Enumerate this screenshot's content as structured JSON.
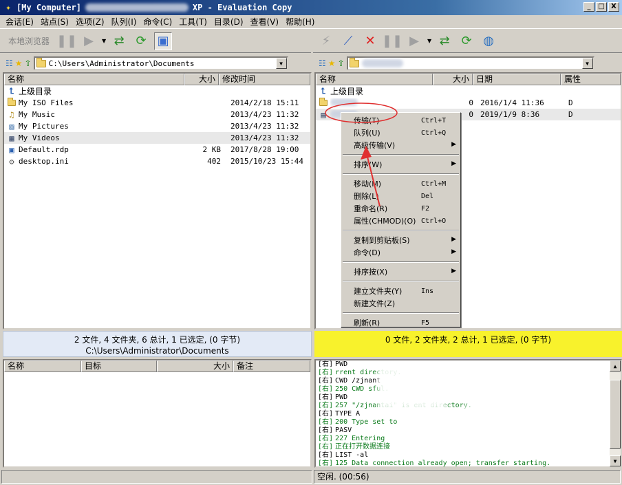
{
  "window": {
    "title_prefix": "[My Computer]",
    "title_suffix": "XP - Evaluation Copy",
    "controls": {
      "minimize": "_",
      "maximize": "□",
      "close": "X"
    }
  },
  "menu": [
    "会话(E)",
    "站点(S)",
    "选项(Z)",
    "队列(I)",
    "命令(C)",
    "工具(T)",
    "目录(D)",
    "查看(V)",
    "帮助(H)"
  ],
  "toolbar": {
    "local_browser": "本地浏览器"
  },
  "left": {
    "path": "C:\\Users\\Administrator\\Documents",
    "columns": {
      "name": "名称",
      "size": "大小",
      "modified": "修改时间"
    },
    "parent": "上级目录",
    "files": [
      {
        "name": "My ISO Files",
        "size": "",
        "date": "2014/2/18 15:11",
        "icon": "folder"
      },
      {
        "name": "My Music",
        "size": "",
        "date": "2013/4/23 11:32",
        "icon": "music-folder"
      },
      {
        "name": "My Pictures",
        "size": "",
        "date": "2013/4/23 11:32",
        "icon": "pictures-folder"
      },
      {
        "name": "My Videos",
        "size": "",
        "date": "2013/4/23 11:32",
        "icon": "videos-folder"
      },
      {
        "name": "Default.rdp",
        "size": "2 KB",
        "date": "2017/8/28 19:00",
        "icon": "rdp-file"
      },
      {
        "name": "desktop.ini",
        "size": "402",
        "date": "2015/10/23 15:44",
        "icon": "ini-file"
      }
    ],
    "status_line1": "2 文件, 4 文件夹, 6 总计, 1 已选定, (0 字节)",
    "status_line2": "C:\\Users\\Administrator\\Documents"
  },
  "right": {
    "columns": {
      "name": "名称",
      "size": "大小",
      "date": "日期",
      "attr": "属性"
    },
    "parent": "上级目录",
    "files": [
      {
        "size": "0",
        "date": "2016/1/4 11:36",
        "attr": "D"
      },
      {
        "size": "0",
        "date": "2019/1/9 8:36",
        "attr": "D"
      }
    ],
    "status": "0 文件, 2 文件夹, 2 总计, 1 已选定, (0 字节)"
  },
  "queue": {
    "columns": {
      "name": "名称",
      "target": "目标",
      "size": "大小",
      "note": "备注"
    }
  },
  "log": [
    {
      "tag": "[右]",
      "text": "PWD",
      "green": false
    },
    {
      "tag": "[右]",
      "text": "rrent directory.",
      "green": true
    },
    {
      "tag": "[右]",
      "text": "CWD /zjnant",
      "green": false
    },
    {
      "tag": "[右]",
      "text": "250 CWD            sful.",
      "green": true
    },
    {
      "tag": "[右]",
      "text": "PWD",
      "green": false
    },
    {
      "tag": "[右]",
      "text": "257 \"/zjnantai\" is    ent directory.",
      "green": true
    },
    {
      "tag": "[右]",
      "text": "TYPE A",
      "green": false
    },
    {
      "tag": "[右]",
      "text": "200 Type set to",
      "green": true
    },
    {
      "tag": "[右]",
      "text": "PASV",
      "green": false
    },
    {
      "tag": "[右]",
      "text": "227 Entering",
      "green": true
    },
    {
      "tag": "[右]",
      "text": "正在打开数据连接",
      "green": true
    },
    {
      "tag": "[右]",
      "text": "LIST -al",
      "green": false
    },
    {
      "tag": "[右]",
      "text": "125 Data connection already open; transfer starting.",
      "green": true
    }
  ],
  "bottom_status": {
    "right": "空闲. (00:56)"
  },
  "context_menu": [
    {
      "label": "传输(T)",
      "key": "Ctrl+T",
      "sub": false
    },
    {
      "label": "队列(U)",
      "key": "Ctrl+Q",
      "sub": false
    },
    {
      "label": "高级传输(V)",
      "key": "",
      "sub": true
    },
    {
      "sep": true
    },
    {
      "label": "排序(W)",
      "key": "",
      "sub": true
    },
    {
      "sep": true
    },
    {
      "label": "移动(M)",
      "key": "Ctrl+M",
      "sub": false
    },
    {
      "label": "删除(L)",
      "key": "Del",
      "sub": false
    },
    {
      "label": "重命名(R)",
      "key": "F2",
      "sub": false
    },
    {
      "label": "属性(CHMOD)(O)",
      "key": "Ctrl+O",
      "sub": false
    },
    {
      "sep": true
    },
    {
      "label": "复制到剪贴板(S)",
      "key": "",
      "sub": true
    },
    {
      "label": "命令(D)",
      "key": "",
      "sub": true
    },
    {
      "sep": true
    },
    {
      "label": "排序按(X)",
      "key": "",
      "sub": true
    },
    {
      "sep": true
    },
    {
      "label": "建立文件夹(Y)",
      "key": "Ins",
      "sub": false
    },
    {
      "label": "新建文件(Z)",
      "key": "",
      "sub": false
    },
    {
      "sep": true
    },
    {
      "label": "刷新(R)",
      "key": "F5",
      "sub": false
    }
  ],
  "colors": {
    "title_bar": "#0a246a",
    "right_status": "#f8f22c",
    "log_green": "#0a7a1a",
    "annotation": "#e03030"
  }
}
